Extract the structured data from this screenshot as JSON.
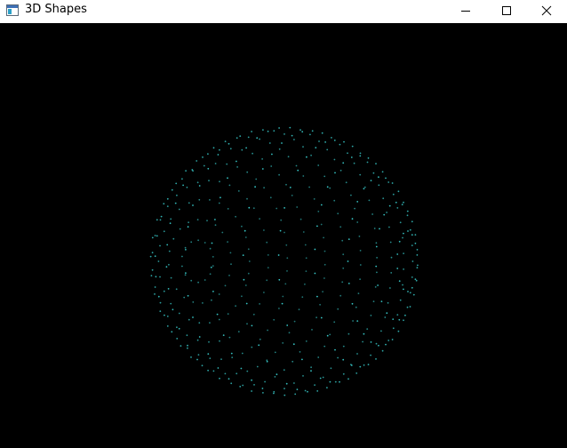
{
  "window": {
    "title": "3D Shapes",
    "icons": {
      "app": "app-window-icon",
      "minimize": "minimize-icon",
      "maximize": "maximize-icon",
      "close": "close-icon"
    }
  },
  "scene": {
    "background": "#000000",
    "point_color": "#37c8c8",
    "shape": "sphere-point-cloud"
  }
}
